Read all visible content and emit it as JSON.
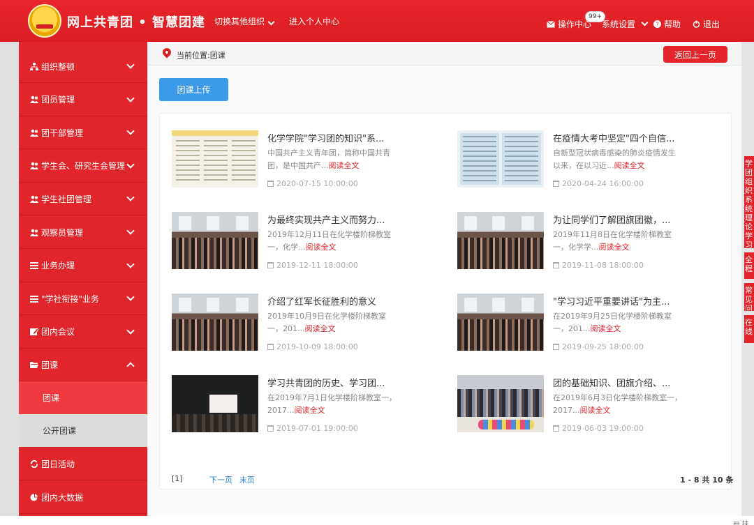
{
  "header": {
    "brand": "网上共青团 • 智慧团建",
    "switch_org": "切换其他组织",
    "personal_center": "进入个人中心",
    "ops_center": "操作中心",
    "ops_badge": "99+",
    "settings": "系统设置",
    "help": "帮助",
    "logout": "退出"
  },
  "sidebar": {
    "items": [
      {
        "label": "组织整顿",
        "icon": "org-chart-icon"
      },
      {
        "label": "团员管理",
        "icon": "users-icon"
      },
      {
        "label": "团干部管理",
        "icon": "users-icon"
      },
      {
        "label": "学生会、研究生会管理",
        "icon": "users-icon"
      },
      {
        "label": "学生社团管理",
        "icon": "users-icon"
      },
      {
        "label": "观察员管理",
        "icon": "users-icon"
      },
      {
        "label": "业务办理",
        "icon": "list-icon"
      },
      {
        "label": "\"学社衔接\"业务",
        "icon": "list-icon"
      },
      {
        "label": "团内会议",
        "icon": "edit-icon"
      },
      {
        "label": "团课",
        "icon": "folder-open-icon"
      }
    ],
    "sub_items": [
      "团课",
      "公开团课"
    ],
    "bottom_items": [
      {
        "label": "团日活动",
        "icon": "refresh-icon"
      },
      {
        "label": "团内大数据",
        "icon": "pie-chart-icon"
      }
    ]
  },
  "breadcrumb": "当前位置:团课",
  "back_button": "返回上一页",
  "upload_button": "团课上传",
  "read_more": "阅读全文",
  "cards": [
    {
      "title": "化学学院\"学习团的知识\"系...",
      "desc": "中国共产主义青年团，简称中国共青团，是中国共产...",
      "date": "2020-07-15 10:00:00"
    },
    {
      "title": "在疫情大考中坚定\"四个自信...",
      "desc": "自新型冠状病毒感染的肺炎疫情发生以来，在以习近...",
      "date": "2020-04-24 16:00:00"
    },
    {
      "title": "为最终实现共产主义而努力...",
      "desc": "2019年12月11日在化学楼阶梯教室一，化学...",
      "date": "2019-12-11 18:00:00"
    },
    {
      "title": "为让同学们了解团旗团徽，...",
      "desc": "2019年11月8日在化学楼阶梯教室一，化学学...",
      "date": "2019-11-08 18:00:00"
    },
    {
      "title": "介绍了红军长征胜利的意义",
      "desc": "2019年10月9日在化学楼阶梯教室一，201...",
      "date": "2019-10-09 18:00:00"
    },
    {
      "title": "\"学习习近平重要讲话\"为主...",
      "desc": "在2019年9月25日化学楼阶梯教室一，201...",
      "date": "2019-09-25 18:00:00"
    },
    {
      "title": "学习共青团的历史、学习团...",
      "desc": "在2019年7月1日化学楼阶梯教室一，2017...",
      "date": "2019-07-01 19:00:00"
    },
    {
      "title": "团的基础知识、团旗介绍、...",
      "desc": "在2019年6月3日化学楼阶梯教室一，2017...",
      "date": "2019-06-03 19:00:00"
    }
  ],
  "pagination": {
    "current": "[1]",
    "next": "下一页",
    "last": "末页",
    "info": "1 - 8  共 10 条"
  },
  "right_tabs": [
    "学团组织系统理论学习（",
    "全程",
    "常见问",
    "在线"
  ],
  "footer_partial": "扶",
  "colors": {
    "primary_red": "#e3242a",
    "upload_blue": "#3d9ae8",
    "link_red": "#d91e23"
  }
}
